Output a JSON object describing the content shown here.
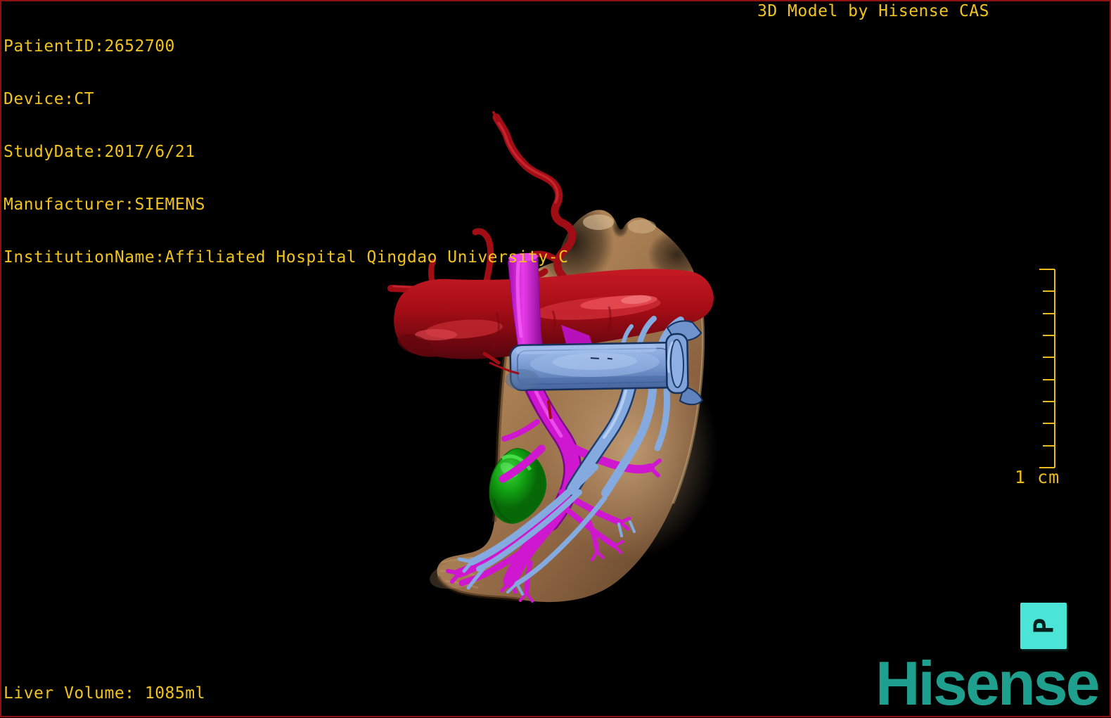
{
  "header": {
    "patient_lines": [
      "PatientID:2652700",
      "Device:CT",
      "StudyDate:2017/6/21",
      "Manufacturer:SIEMENS",
      "InstitutionName:Affiliated Hospital Qingdao University-C"
    ],
    "title": "3D Model by Hisense CAS"
  },
  "footer": {
    "liver_volume": "Liver Volume: 1085ml"
  },
  "scale_bar": {
    "label": "1 cm",
    "tick_count": 10,
    "color": "#EABB1F"
  },
  "orientation_marker": {
    "label": "P",
    "background_color": "#4BE5D8"
  },
  "branding": {
    "logo_text": "Hisense",
    "logo_color": "#1FA08F"
  },
  "overlay_text_color": "#F2C31F",
  "border_color": "#8E1010",
  "model": {
    "description": "3D liver model with vasculature",
    "structures": [
      {
        "name": "liver",
        "color": "#AD8258"
      },
      {
        "name": "hepatic-artery",
        "color": "#B5121B"
      },
      {
        "name": "portal-vein",
        "color": "#CE17CE"
      },
      {
        "name": "hepatic-vein",
        "color": "#7E9FD6"
      },
      {
        "name": "gallbladder",
        "color": "#12A612"
      }
    ]
  }
}
